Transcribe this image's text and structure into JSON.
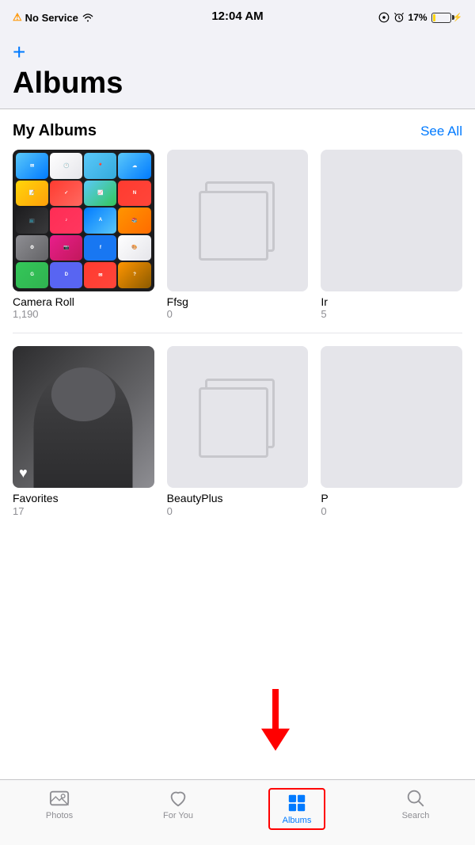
{
  "statusBar": {
    "noService": "No Service",
    "time": "12:04 AM",
    "battery": "17%"
  },
  "nav": {
    "addBtn": "+",
    "pageTitle": "Albums"
  },
  "myAlbums": {
    "sectionTitle": "My Albums",
    "seeAll": "See All",
    "albums": [
      {
        "name": "Camera Roll",
        "count": "1,190",
        "type": "camera-roll"
      },
      {
        "name": "Ffsg",
        "count": "0",
        "type": "empty"
      },
      {
        "name": "Ir",
        "count": "5",
        "type": "partial"
      },
      {
        "name": "Favorites",
        "count": "17",
        "type": "favorites"
      },
      {
        "name": "BeautyPlus",
        "count": "0",
        "type": "empty"
      },
      {
        "name": "P",
        "count": "0",
        "type": "partial"
      }
    ]
  },
  "tabBar": {
    "tabs": [
      {
        "id": "photos",
        "label": "Photos",
        "active": false
      },
      {
        "id": "for-you",
        "label": "For You",
        "active": false
      },
      {
        "id": "albums",
        "label": "Albums",
        "active": true
      },
      {
        "id": "search",
        "label": "Search",
        "active": false
      }
    ]
  }
}
